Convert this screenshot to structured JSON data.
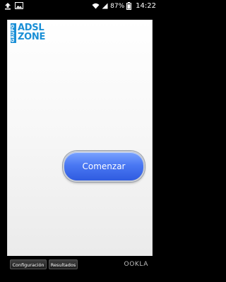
{
  "status_bar": {
    "battery_percent": "87%",
    "time": "14:22",
    "icons": [
      "upload-icon",
      "gallery-icon",
      "wifi-icon",
      "signal-icon",
      "battery-icon"
    ]
  },
  "logo": {
    "vertical_text": "GRUPO",
    "line1": "ADSL",
    "line2": "ZONE",
    "color": "#1a8fd6"
  },
  "main": {
    "start_button_label": "Comenzar",
    "button_color": "#4a78f3"
  },
  "bottom_bar": {
    "config_label": "Configuración",
    "results_label": "Resultados",
    "brand": "OOKLA"
  }
}
